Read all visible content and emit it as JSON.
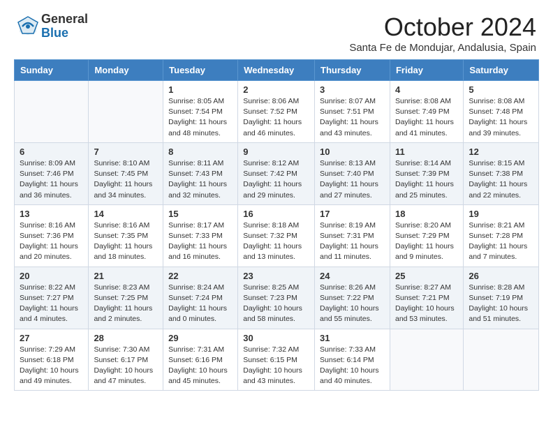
{
  "header": {
    "logo_general": "General",
    "logo_blue": "Blue",
    "month_title": "October 2024",
    "location": "Santa Fe de Mondujar, Andalusia, Spain"
  },
  "weekdays": [
    "Sunday",
    "Monday",
    "Tuesday",
    "Wednesday",
    "Thursday",
    "Friday",
    "Saturday"
  ],
  "weeks": [
    [
      {
        "day": "",
        "info": ""
      },
      {
        "day": "",
        "info": ""
      },
      {
        "day": "1",
        "info": "Sunrise: 8:05 AM\nSunset: 7:54 PM\nDaylight: 11 hours and 48 minutes."
      },
      {
        "day": "2",
        "info": "Sunrise: 8:06 AM\nSunset: 7:52 PM\nDaylight: 11 hours and 46 minutes."
      },
      {
        "day": "3",
        "info": "Sunrise: 8:07 AM\nSunset: 7:51 PM\nDaylight: 11 hours and 43 minutes."
      },
      {
        "day": "4",
        "info": "Sunrise: 8:08 AM\nSunset: 7:49 PM\nDaylight: 11 hours and 41 minutes."
      },
      {
        "day": "5",
        "info": "Sunrise: 8:08 AM\nSunset: 7:48 PM\nDaylight: 11 hours and 39 minutes."
      }
    ],
    [
      {
        "day": "6",
        "info": "Sunrise: 8:09 AM\nSunset: 7:46 PM\nDaylight: 11 hours and 36 minutes."
      },
      {
        "day": "7",
        "info": "Sunrise: 8:10 AM\nSunset: 7:45 PM\nDaylight: 11 hours and 34 minutes."
      },
      {
        "day": "8",
        "info": "Sunrise: 8:11 AM\nSunset: 7:43 PM\nDaylight: 11 hours and 32 minutes."
      },
      {
        "day": "9",
        "info": "Sunrise: 8:12 AM\nSunset: 7:42 PM\nDaylight: 11 hours and 29 minutes."
      },
      {
        "day": "10",
        "info": "Sunrise: 8:13 AM\nSunset: 7:40 PM\nDaylight: 11 hours and 27 minutes."
      },
      {
        "day": "11",
        "info": "Sunrise: 8:14 AM\nSunset: 7:39 PM\nDaylight: 11 hours and 25 minutes."
      },
      {
        "day": "12",
        "info": "Sunrise: 8:15 AM\nSunset: 7:38 PM\nDaylight: 11 hours and 22 minutes."
      }
    ],
    [
      {
        "day": "13",
        "info": "Sunrise: 8:16 AM\nSunset: 7:36 PM\nDaylight: 11 hours and 20 minutes."
      },
      {
        "day": "14",
        "info": "Sunrise: 8:16 AM\nSunset: 7:35 PM\nDaylight: 11 hours and 18 minutes."
      },
      {
        "day": "15",
        "info": "Sunrise: 8:17 AM\nSunset: 7:33 PM\nDaylight: 11 hours and 16 minutes."
      },
      {
        "day": "16",
        "info": "Sunrise: 8:18 AM\nSunset: 7:32 PM\nDaylight: 11 hours and 13 minutes."
      },
      {
        "day": "17",
        "info": "Sunrise: 8:19 AM\nSunset: 7:31 PM\nDaylight: 11 hours and 11 minutes."
      },
      {
        "day": "18",
        "info": "Sunrise: 8:20 AM\nSunset: 7:29 PM\nDaylight: 11 hours and 9 minutes."
      },
      {
        "day": "19",
        "info": "Sunrise: 8:21 AM\nSunset: 7:28 PM\nDaylight: 11 hours and 7 minutes."
      }
    ],
    [
      {
        "day": "20",
        "info": "Sunrise: 8:22 AM\nSunset: 7:27 PM\nDaylight: 11 hours and 4 minutes."
      },
      {
        "day": "21",
        "info": "Sunrise: 8:23 AM\nSunset: 7:25 PM\nDaylight: 11 hours and 2 minutes."
      },
      {
        "day": "22",
        "info": "Sunrise: 8:24 AM\nSunset: 7:24 PM\nDaylight: 11 hours and 0 minutes."
      },
      {
        "day": "23",
        "info": "Sunrise: 8:25 AM\nSunset: 7:23 PM\nDaylight: 10 hours and 58 minutes."
      },
      {
        "day": "24",
        "info": "Sunrise: 8:26 AM\nSunset: 7:22 PM\nDaylight: 10 hours and 55 minutes."
      },
      {
        "day": "25",
        "info": "Sunrise: 8:27 AM\nSunset: 7:21 PM\nDaylight: 10 hours and 53 minutes."
      },
      {
        "day": "26",
        "info": "Sunrise: 8:28 AM\nSunset: 7:19 PM\nDaylight: 10 hours and 51 minutes."
      }
    ],
    [
      {
        "day": "27",
        "info": "Sunrise: 7:29 AM\nSunset: 6:18 PM\nDaylight: 10 hours and 49 minutes."
      },
      {
        "day": "28",
        "info": "Sunrise: 7:30 AM\nSunset: 6:17 PM\nDaylight: 10 hours and 47 minutes."
      },
      {
        "day": "29",
        "info": "Sunrise: 7:31 AM\nSunset: 6:16 PM\nDaylight: 10 hours and 45 minutes."
      },
      {
        "day": "30",
        "info": "Sunrise: 7:32 AM\nSunset: 6:15 PM\nDaylight: 10 hours and 43 minutes."
      },
      {
        "day": "31",
        "info": "Sunrise: 7:33 AM\nSunset: 6:14 PM\nDaylight: 10 hours and 40 minutes."
      },
      {
        "day": "",
        "info": ""
      },
      {
        "day": "",
        "info": ""
      }
    ]
  ]
}
